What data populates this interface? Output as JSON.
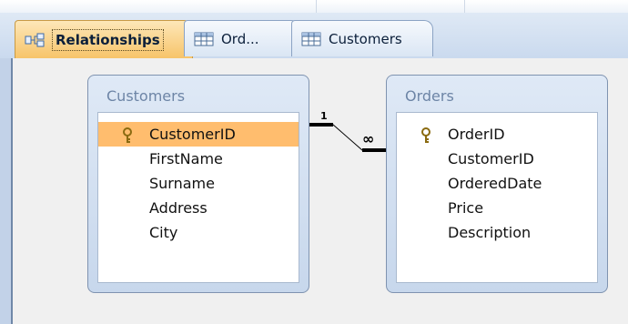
{
  "tabs": [
    {
      "label": "Relationships",
      "icon": "relationships-icon",
      "active": true
    },
    {
      "label": "Ord...",
      "icon": "table-icon",
      "active": false
    },
    {
      "label": "Customers",
      "icon": "table-icon",
      "active": false
    }
  ],
  "tables": {
    "customers": {
      "title": "Customers",
      "fields": [
        "CustomerID",
        "FirstName",
        "Surname",
        "Address",
        "City"
      ],
      "key_field": "CustomerID",
      "selected_field": "CustomerID"
    },
    "orders": {
      "title": "Orders",
      "fields": [
        "OrderID",
        "CustomerID",
        "OrderedDate",
        "Price",
        "Description"
      ],
      "key_field": "OrderID"
    }
  },
  "relationship": {
    "from_table": "Customers",
    "from_field": "CustomerID",
    "to_table": "Orders",
    "to_field": "CustomerID",
    "one_label": "1",
    "many_label": "∞"
  },
  "colors": {
    "selected_row": "#ffbd6e",
    "active_tab": "#f7c46a",
    "table_title": "#6d85a6"
  }
}
